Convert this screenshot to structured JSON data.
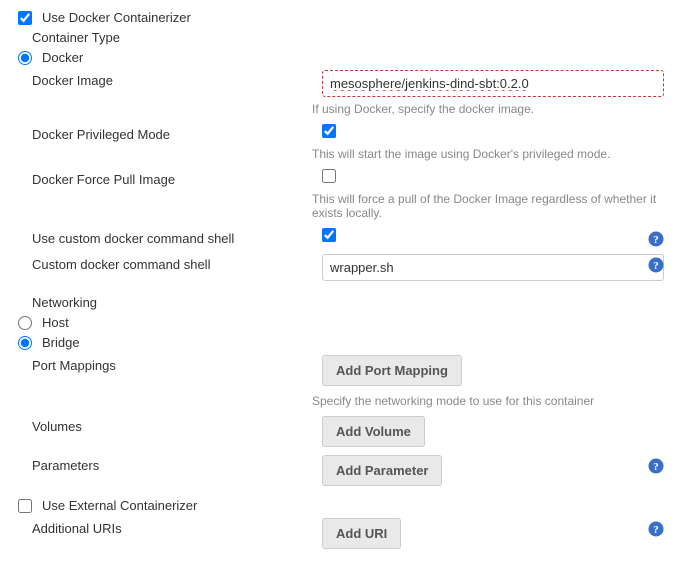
{
  "useDockerContainerizer": {
    "label": "Use Docker Containerizer",
    "checked": true
  },
  "containerTypeLabel": "Container Type",
  "containerType": {
    "dockerLabel": "Docker",
    "dockerSelected": true,
    "hostLabel": "Host",
    "hostSelected": false,
    "bridgeLabel": "Bridge",
    "bridgeSelected": true
  },
  "dockerImage": {
    "label": "Docker Image",
    "value": "mesosphere/jenkins-dind-sbt:0.2.0",
    "hint": "If using Docker, specify the docker image."
  },
  "privilegedMode": {
    "label": "Docker Privileged Mode",
    "checked": true,
    "hint": "This will start the image using Docker's privileged mode."
  },
  "forcePull": {
    "label": "Docker Force Pull Image",
    "checked": false,
    "hint": "This will force a pull of the Docker Image regardless of whether it exists locally."
  },
  "useCustomShell": {
    "label": "Use custom docker command shell",
    "checked": true
  },
  "customShell": {
    "label": "Custom docker command shell",
    "value": "wrapper.sh"
  },
  "networkingLabel": "Networking",
  "portMappings": {
    "label": "Port Mappings",
    "button": "Add Port Mapping",
    "hint": "Specify the networking mode to use for this container"
  },
  "volumes": {
    "label": "Volumes",
    "button": "Add Volume"
  },
  "parameters": {
    "label": "Parameters",
    "button": "Add Parameter"
  },
  "useExternal": {
    "label": "Use External Containerizer",
    "checked": false
  },
  "additionalURIs": {
    "label": "Additional URIs",
    "button": "Add URI"
  }
}
